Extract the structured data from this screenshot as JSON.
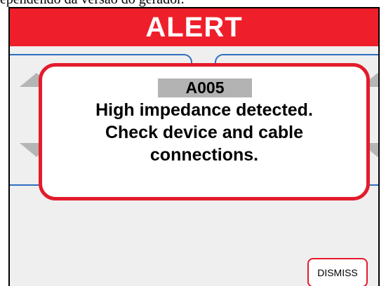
{
  "caption": "ependendo da versão do gerador.",
  "banner": {
    "title": "ALERT"
  },
  "alert": {
    "code": "A005",
    "message_lines": [
      "High impedance detected.",
      "Check device and cable",
      "connections."
    ]
  },
  "dismiss_label": "DISMISS",
  "colors": {
    "banner_red": "#ee1f2b",
    "modal_border": "#e31b2b",
    "panel_border": "#2f6fc0",
    "code_bg": "#b3b3b3",
    "screen_bg": "#efefef"
  }
}
